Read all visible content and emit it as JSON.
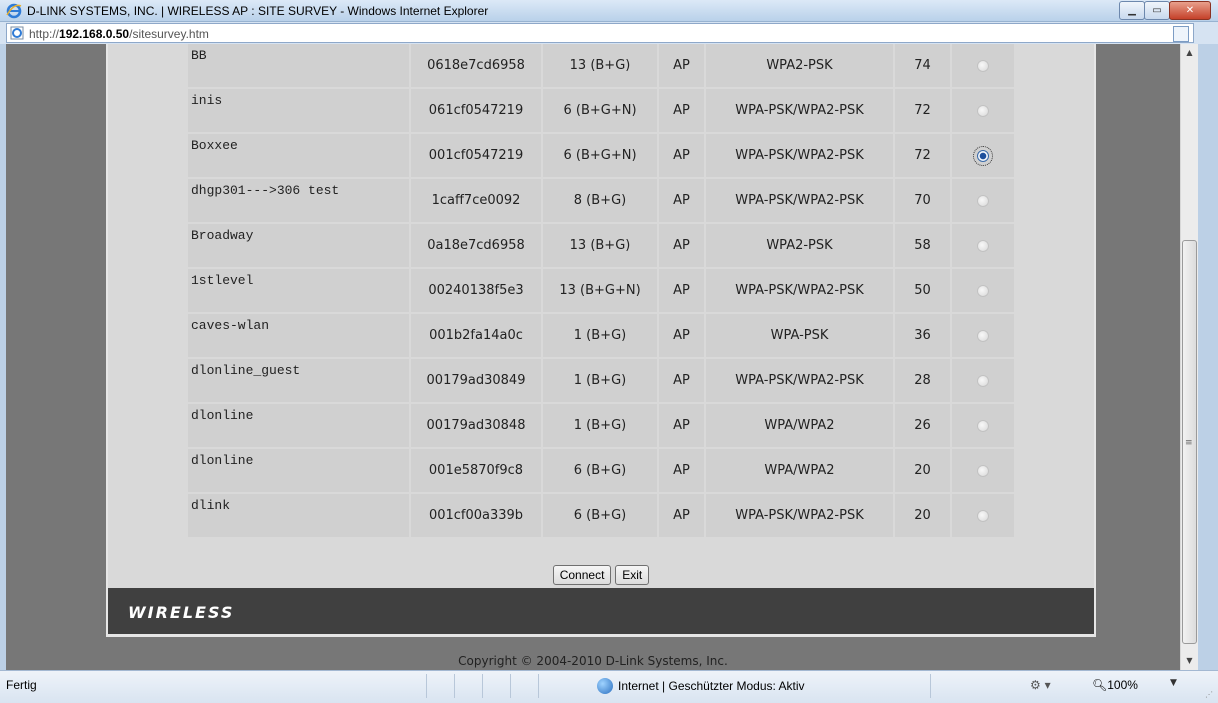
{
  "window": {
    "title": "D-LINK SYSTEMS, INC. | WIRELESS AP : SITE SURVEY - Windows Internet Explorer",
    "url_prefix": "http://",
    "url_host": "192.168.0.50",
    "url_path": "/sitesurvey.htm"
  },
  "survey": {
    "rows": [
      {
        "ssid": "BB",
        "mac": "0618e7cd6958",
        "channel": "13 (B+G)",
        "type": "AP",
        "security": "WPA2-PSK",
        "signal": "74",
        "selected": false
      },
      {
        "ssid": "inis",
        "mac": "061cf0547219",
        "channel": "6 (B+G+N)",
        "type": "AP",
        "security": "WPA-PSK/WPA2-PSK",
        "signal": "72",
        "selected": false
      },
      {
        "ssid": "Boxxee",
        "mac": "001cf0547219",
        "channel": "6 (B+G+N)",
        "type": "AP",
        "security": "WPA-PSK/WPA2-PSK",
        "signal": "72",
        "selected": true
      },
      {
        "ssid": "dhgp301--->306 test",
        "mac": "1caff7ce0092",
        "channel": "8 (B+G)",
        "type": "AP",
        "security": "WPA-PSK/WPA2-PSK",
        "signal": "70",
        "selected": false
      },
      {
        "ssid": "Broadway",
        "mac": "0a18e7cd6958",
        "channel": "13 (B+G)",
        "type": "AP",
        "security": "WPA2-PSK",
        "signal": "58",
        "selected": false
      },
      {
        "ssid": "1stlevel",
        "mac": "00240138f5e3",
        "channel": "13 (B+G+N)",
        "type": "AP",
        "security": "WPA-PSK/WPA2-PSK",
        "signal": "50",
        "selected": false
      },
      {
        "ssid": "caves-wlan",
        "mac": "001b2fa14a0c",
        "channel": "1 (B+G)",
        "type": "AP",
        "security": "WPA-PSK",
        "signal": "36",
        "selected": false
      },
      {
        "ssid": "dlonline_guest",
        "mac": "00179ad30849",
        "channel": "1 (B+G)",
        "type": "AP",
        "security": "WPA-PSK/WPA2-PSK",
        "signal": "28",
        "selected": false
      },
      {
        "ssid": "dlonline",
        "mac": "00179ad30848",
        "channel": "1 (B+G)",
        "type": "AP",
        "security": "WPA/WPA2",
        "signal": "26",
        "selected": false
      },
      {
        "ssid": "dlonline",
        "mac": "001e5870f9c8",
        "channel": "6 (B+G)",
        "type": "AP",
        "security": "WPA/WPA2",
        "signal": "20",
        "selected": false
      },
      {
        "ssid": "dlink",
        "mac": "001cf00a339b",
        "channel": "6 (B+G)",
        "type": "AP",
        "security": "WPA-PSK/WPA2-PSK",
        "signal": "20",
        "selected": false
      }
    ],
    "connect_label": "Connect",
    "exit_label": "Exit"
  },
  "footer": {
    "brand": "WIRELESS",
    "copyright": "Copyright © 2004-2010 D-Link Systems, Inc."
  },
  "statusbar": {
    "status": "Fertig",
    "zone": "Internet | Geschützter Modus: Aktiv",
    "zoom": "100%"
  },
  "colors": {
    "panel": "#d9d9d9",
    "cell": "#d0d0d0",
    "footer_bar": "#404040",
    "page_bg": "#777777"
  }
}
